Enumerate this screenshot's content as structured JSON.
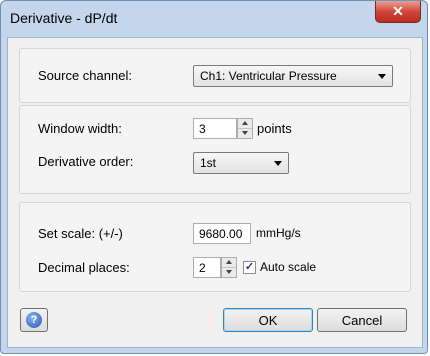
{
  "window": {
    "title": "Derivative - dP/dt",
    "close_glyph": "✕"
  },
  "source": {
    "label": "Source channel:",
    "value": "Ch1: Ventricular Pressure"
  },
  "window_width": {
    "label": "Window width:",
    "value": "3",
    "unit": "points"
  },
  "derivative_order": {
    "label": "Derivative order:",
    "value": "1st"
  },
  "scale": {
    "label": "Set scale: (+/-)",
    "value": "9680.00",
    "unit": "mmHg/s"
  },
  "decimal_places": {
    "label": "Decimal places:",
    "value": "2"
  },
  "auto_scale": {
    "label": "Auto scale",
    "checked": true,
    "check_glyph": "✓"
  },
  "buttons": {
    "help_glyph": "?",
    "ok": "OK",
    "cancel": "Cancel"
  }
}
